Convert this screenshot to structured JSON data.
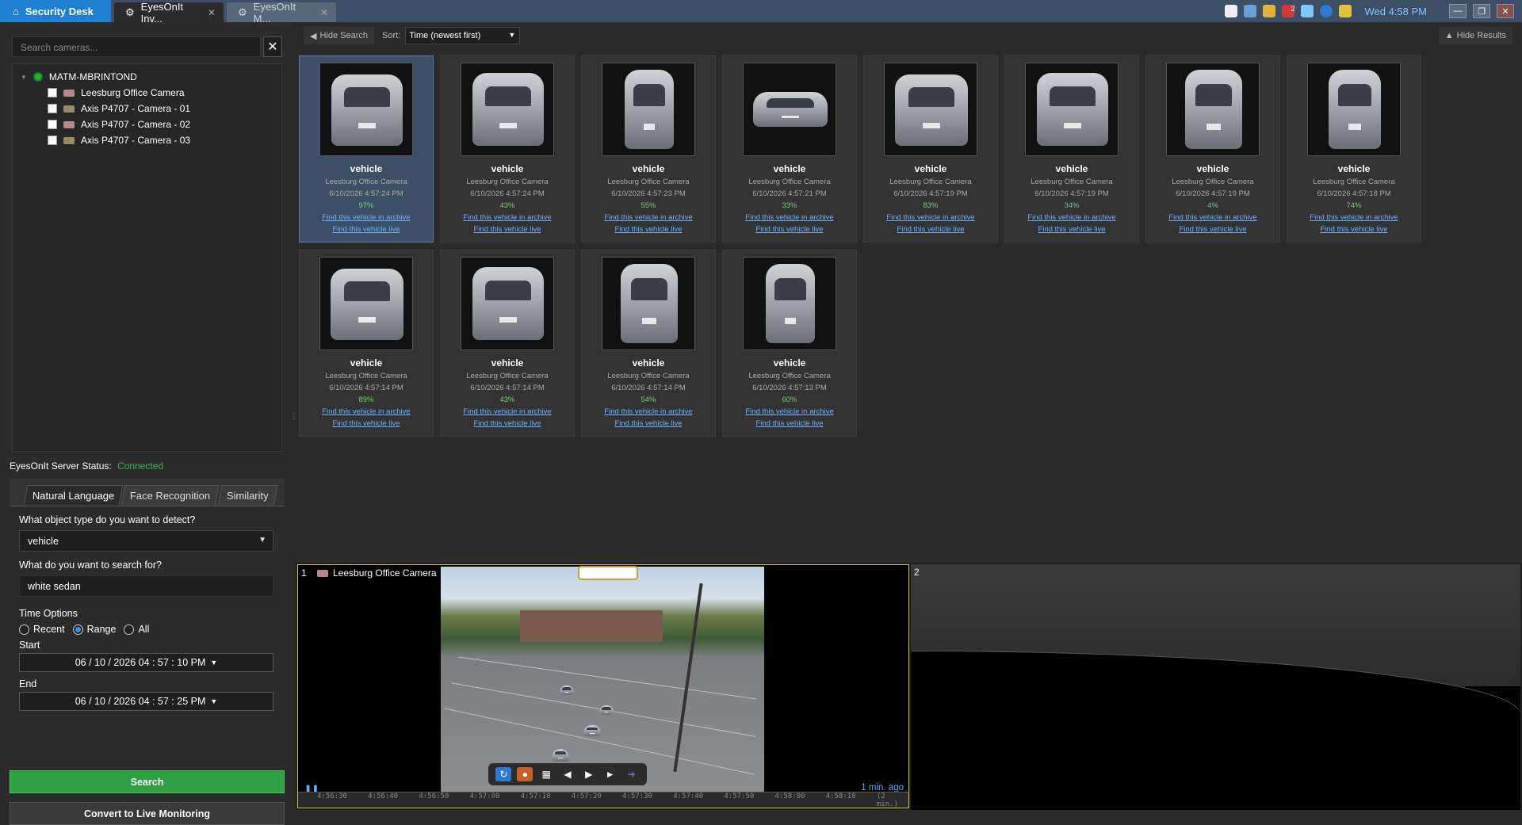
{
  "titlebar": {
    "home_label": "Security Desk",
    "tabs": [
      {
        "label": "EyesOnIt Inv...",
        "active": true
      },
      {
        "label": "EyesOnIt M...",
        "active": false
      }
    ],
    "clock": "Wed 4:58 PM",
    "tray_badge": "2"
  },
  "left": {
    "search_placeholder": "Search cameras...",
    "tree": {
      "root": "MATM-MBRINTOND",
      "items": [
        "Leesburg Office Camera",
        "Axis P4707  - Camera - 01",
        "Axis P4707  - Camera - 02",
        "Axis P4707  - Camera - 03"
      ]
    },
    "server_status_label": "EyesOnIt Server Status:",
    "server_status_value": "Connected",
    "tabs": [
      "Natural Language",
      "Face Recognition",
      "Similarity"
    ],
    "object_question": "What object type do you want to detect?",
    "object_value": "vehicle",
    "search_question": "What do you want to search for?",
    "search_value": "white sedan",
    "time_options_label": "Time Options",
    "radio_recent": "Recent",
    "radio_range": "Range",
    "radio_all": "All",
    "start_label": "Start",
    "start_value": "06 / 10 / 2026   04 : 57 : 10 PM",
    "end_label": "End",
    "end_value": "06 / 10 / 2026   04 : 57 : 25 PM",
    "search_button": "Search",
    "live_button": "Convert to Live Monitoring"
  },
  "results": {
    "hide_search": "Hide Search",
    "sort_label": "Sort:",
    "sort_value": "Time (newest first)",
    "hide_results": "Hide Results",
    "cards": [
      {
        "title": "vehicle",
        "camera": "Leesburg Office Camera",
        "time": "6/10/2026 4:57:24 PM",
        "conf": "97%",
        "archive": "Find this vehicle in archive",
        "live": "Find this vehicle live"
      },
      {
        "title": "vehicle",
        "camera": "Leesburg Office Camera",
        "time": "6/10/2026 4:57:24 PM",
        "conf": "43%",
        "archive": "Find this vehicle in archive",
        "live": "Find this vehicle live"
      },
      {
        "title": "vehicle",
        "camera": "Leesburg Office Camera",
        "time": "6/10/2026 4:57:23 PM",
        "conf": "55%",
        "archive": "Find this vehicle in archive",
        "live": "Find this vehicle live"
      },
      {
        "title": "vehicle",
        "camera": "Leesburg Office Camera",
        "time": "6/10/2026 4:57:21 PM",
        "conf": "33%",
        "archive": "Find this vehicle in archive",
        "live": "Find this vehicle live"
      },
      {
        "title": "vehicle",
        "camera": "Leesburg Office Camera",
        "time": "6/10/2026 4:57:19 PM",
        "conf": "83%",
        "archive": "Find this vehicle in archive",
        "live": "Find this vehicle live"
      },
      {
        "title": "vehicle",
        "camera": "Leesburg Office Camera",
        "time": "6/10/2026 4:57:19 PM",
        "conf": "34%",
        "archive": "Find this vehicle in archive",
        "live": "Find this vehicle live"
      },
      {
        "title": "vehicle",
        "camera": "Leesburg Office Camera",
        "time": "6/10/2026 4:57:19 PM",
        "conf": "4%",
        "archive": "Find this vehicle in archive",
        "live": "Find this vehicle live"
      },
      {
        "title": "vehicle",
        "camera": "Leesburg Office Camera",
        "time": "6/10/2026 4:57:18 PM",
        "conf": "74%",
        "archive": "Find this vehicle in archive",
        "live": "Find this vehicle live"
      },
      {
        "title": "vehicle",
        "camera": "Leesburg Office Camera",
        "time": "6/10/2026 4:57:14 PM",
        "conf": "89%",
        "archive": "Find this vehicle in archive",
        "live": "Find this vehicle live"
      },
      {
        "title": "vehicle",
        "camera": "Leesburg Office Camera",
        "time": "6/10/2026 4:57:14 PM",
        "conf": "43%",
        "archive": "Find this vehicle in archive",
        "live": "Find this vehicle live"
      },
      {
        "title": "vehicle",
        "camera": "Leesburg Office Camera",
        "time": "6/10/2026 4:57:14 PM",
        "conf": "54%",
        "archive": "Find this vehicle in archive",
        "live": "Find this vehicle live"
      },
      {
        "title": "vehicle",
        "camera": "Leesburg Office Camera",
        "time": "6/10/2026 4:57:13 PM",
        "conf": "60%",
        "archive": "Find this vehicle in archive",
        "live": "Find this vehicle live"
      }
    ]
  },
  "video": {
    "tile1_num": "1",
    "tile1_camera": "Leesburg Office Camera",
    "tile1_ago": "1 min. ago",
    "tile2_num": "2",
    "timeline_labels": [
      "4:56:30",
      "4:56:40",
      "4:56:50",
      "4:57:00",
      "4:57:10",
      "4:57:20",
      "4:57:30",
      "4:57:40",
      "4:57:50",
      "4:58:00",
      "4:58:10",
      "(2 min.)"
    ]
  }
}
